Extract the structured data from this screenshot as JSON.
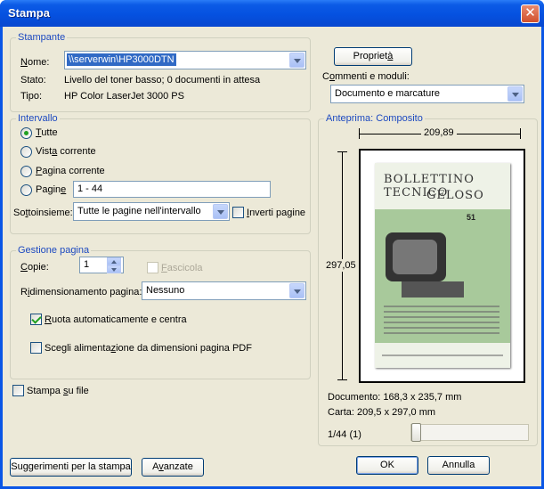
{
  "window": {
    "title": "Stampa",
    "close_glyph": "✕"
  },
  "printer": {
    "group_label": "Stampante",
    "name_label_pre": "",
    "name_label_u": "N",
    "name_label_post": "ome:",
    "name_value": "\\\\serverwin\\HP3000DTN",
    "status_label": "Stato:",
    "status_value": "Livello del toner basso; 0 documenti in attesa",
    "type_label": "Tipo:",
    "type_value": "HP Color LaserJet 3000 PS",
    "properties_pre": "Propriet",
    "properties_u": "à",
    "properties_post": "",
    "comments_pre": "C",
    "comments_u": "o",
    "comments_post": "mmenti e moduli:",
    "comments_value": "Documento e marcature"
  },
  "range": {
    "group_label": "Intervallo",
    "all_pre": "",
    "all_u": "T",
    "all_post": "utte",
    "current_view_pre": "Vist",
    "current_view_u": "a",
    "current_view_post": " corrente",
    "current_page_pre": "",
    "current_page_u": "P",
    "current_page_post": "agina corrente",
    "pages_pre": "Pagin",
    "pages_u": "e",
    "pages_post": "",
    "pages_value": "1 - 44",
    "subset_pre": "So",
    "subset_u": "t",
    "subset_post": "toinsieme:",
    "subset_value": "Tutte le pagine nell'intervallo",
    "reverse_pre": "",
    "reverse_u": "I",
    "reverse_post": "nverti pagine"
  },
  "handling": {
    "group_label": "Gestione pagina",
    "copies_pre": "",
    "copies_u": "C",
    "copies_post": "opie:",
    "copies_value": "1",
    "collate_pre": "",
    "collate_u": "F",
    "collate_post": "ascicola",
    "scaling_pre": "R",
    "scaling_u": "i",
    "scaling_post": "dimensionamento pagina:",
    "scaling_value": "Nessuno",
    "autorotate_pre": "",
    "autorotate_u": "R",
    "autorotate_post": "uota automaticamente e centra",
    "paper_source_pre": "Scegli alimenta",
    "paper_source_u": "z",
    "paper_source_post": "ione da dimensioni pagina PDF"
  },
  "print_to_file": {
    "pre": "Stampa ",
    "u": "s",
    "post": "u file"
  },
  "preview": {
    "group_label": "Anteprima: Composito",
    "width_label": "209,89",
    "height_label": "297,05",
    "cover_title_1": "BOLLETTINO TECNICO",
    "cover_title_2": "GELOSO",
    "cover_number": "51",
    "document_size": "Documento: 168,3 x 235,7 mm",
    "paper_size": "Carta: 209,5 x 297,0 mm",
    "page_counter": "1/44 (1)"
  },
  "buttons": {
    "tips": "Suggerimenti per la stampa",
    "advanced_pre": "A",
    "advanced_u": "v",
    "advanced_post": "anzate",
    "ok": "OK",
    "cancel": "Annulla"
  }
}
